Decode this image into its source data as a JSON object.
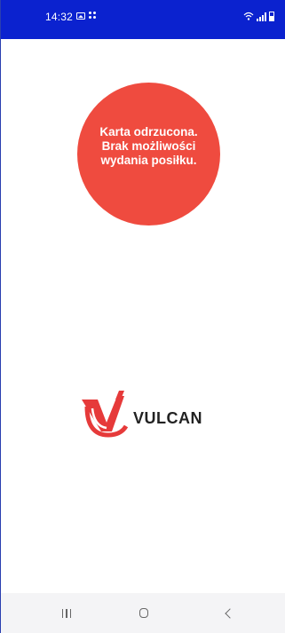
{
  "status_bar": {
    "time": "14:32",
    "icons": [
      "gallery-icon",
      "apps-grid-icon",
      "wifi-icon",
      "signal-icon",
      "battery-icon"
    ],
    "background": "#0b22cf"
  },
  "message": {
    "text": "Karta odrzucona. Brak możliwości wydania posiłku.",
    "circle_color": "#ef4b3f"
  },
  "logo": {
    "brand": "VULCAN",
    "mark_color": "#e63a3a"
  },
  "nav_bar": {
    "buttons": [
      "recents-icon",
      "home-icon",
      "back-icon"
    ]
  }
}
